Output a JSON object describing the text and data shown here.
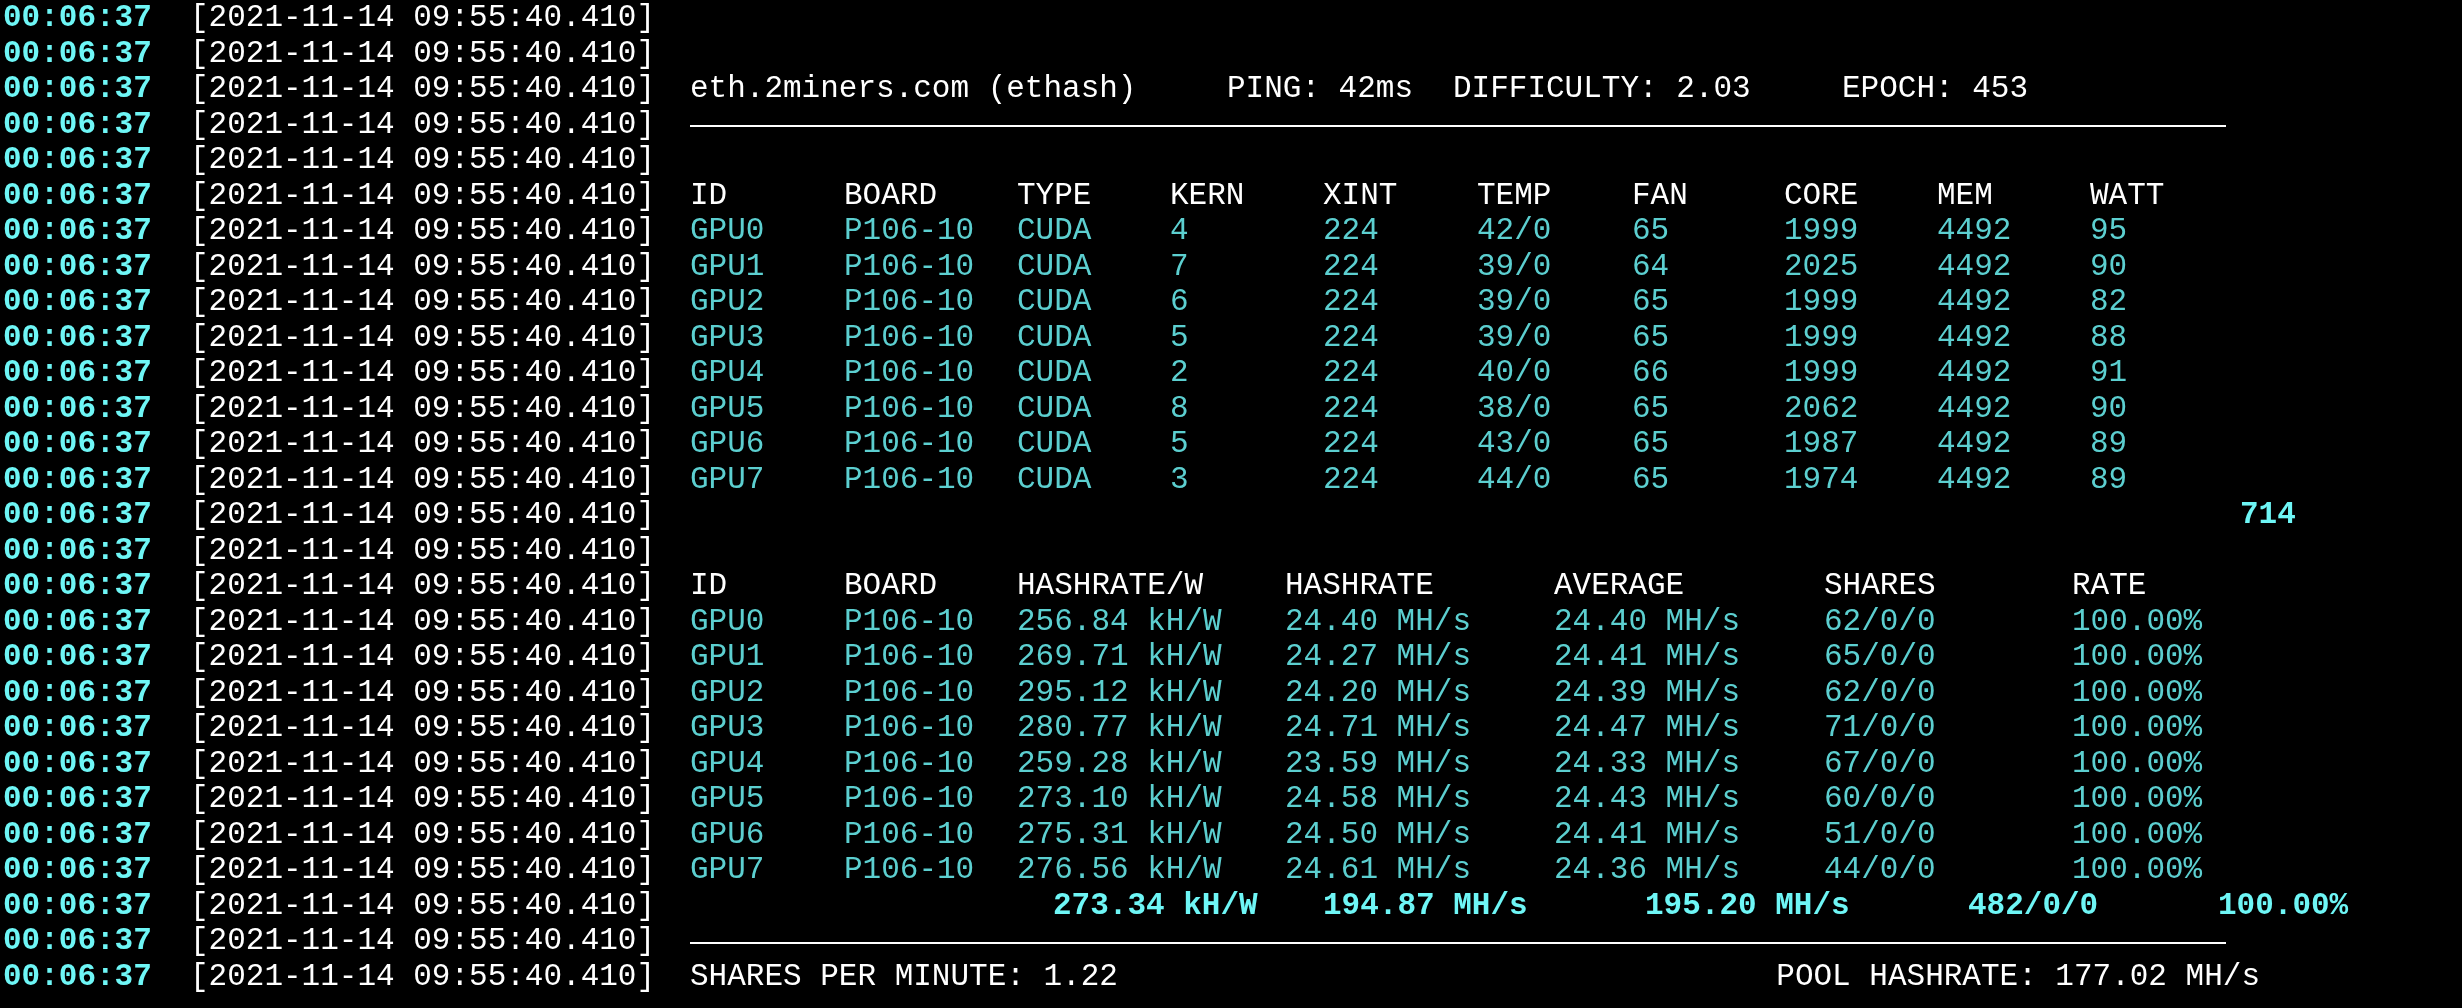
{
  "lines": [
    {
      "time": "00:06:37",
      "stamp": "[2021-11-14 09:55:40.410]",
      "kind": "blank"
    },
    {
      "time": "00:06:37",
      "stamp": "[2021-11-14 09:55:40.410]",
      "kind": "blank"
    },
    {
      "time": "00:06:37",
      "stamp": "[2021-11-14 09:55:40.410]",
      "kind": "pool",
      "cells": [
        "eth.2miners.com (ethash)",
        "PING: 42ms",
        "DIFFICULTY: 2.03",
        "EPOCH: 453"
      ]
    },
    {
      "time": "00:06:37",
      "stamp": "[2021-11-14 09:55:40.410]",
      "kind": "rule"
    },
    {
      "time": "00:06:37",
      "stamp": "[2021-11-14 09:55:40.410]",
      "kind": "blank"
    },
    {
      "time": "00:06:37",
      "stamp": "[2021-11-14 09:55:40.410]",
      "kind": "header1",
      "cells": [
        "ID",
        "BOARD",
        "TYPE",
        "KERN",
        "XINT",
        "TEMP",
        "FAN",
        "CORE",
        "MEM",
        "WATT"
      ]
    },
    {
      "time": "00:06:37",
      "stamp": "[2021-11-14 09:55:40.410]",
      "kind": "row1",
      "cells": [
        "GPU0",
        "P106-10",
        "CUDA",
        "4",
        "224",
        "42/0",
        "65",
        "1999",
        "4492",
        "95"
      ]
    },
    {
      "time": "00:06:37",
      "stamp": "[2021-11-14 09:55:40.410]",
      "kind": "row1",
      "cells": [
        "GPU1",
        "P106-10",
        "CUDA",
        "7",
        "224",
        "39/0",
        "64",
        "2025",
        "4492",
        "90"
      ]
    },
    {
      "time": "00:06:37",
      "stamp": "[2021-11-14 09:55:40.410]",
      "kind": "row1",
      "cells": [
        "GPU2",
        "P106-10",
        "CUDA",
        "6",
        "224",
        "39/0",
        "65",
        "1999",
        "4492",
        "82"
      ]
    },
    {
      "time": "00:06:37",
      "stamp": "[2021-11-14 09:55:40.410]",
      "kind": "row1",
      "cells": [
        "GPU3",
        "P106-10",
        "CUDA",
        "5",
        "224",
        "39/0",
        "65",
        "1999",
        "4492",
        "88"
      ]
    },
    {
      "time": "00:06:37",
      "stamp": "[2021-11-14 09:55:40.410]",
      "kind": "row1",
      "cells": [
        "GPU4",
        "P106-10",
        "CUDA",
        "2",
        "224",
        "40/0",
        "66",
        "1999",
        "4492",
        "91"
      ]
    },
    {
      "time": "00:06:37",
      "stamp": "[2021-11-14 09:55:40.410]",
      "kind": "row1",
      "cells": [
        "GPU5",
        "P106-10",
        "CUDA",
        "8",
        "224",
        "38/0",
        "65",
        "2062",
        "4492",
        "90"
      ]
    },
    {
      "time": "00:06:37",
      "stamp": "[2021-11-14 09:55:40.410]",
      "kind": "row1",
      "cells": [
        "GPU6",
        "P106-10",
        "CUDA",
        "5",
        "224",
        "43/0",
        "65",
        "1987",
        "4492",
        "89"
      ]
    },
    {
      "time": "00:06:37",
      "stamp": "[2021-11-14 09:55:40.410]",
      "kind": "row1",
      "cells": [
        "GPU7",
        "P106-10",
        "CUDA",
        "3",
        "224",
        "44/0",
        "65",
        "1974",
        "4492",
        "89"
      ]
    },
    {
      "time": "00:06:37",
      "stamp": "[2021-11-14 09:55:40.410]",
      "kind": "total1",
      "cells": [
        "714"
      ]
    },
    {
      "time": "00:06:37",
      "stamp": "[2021-11-14 09:55:40.410]",
      "kind": "blank"
    },
    {
      "time": "00:06:37",
      "stamp": "[2021-11-14 09:55:40.410]",
      "kind": "header2",
      "cells": [
        "ID",
        "BOARD",
        "HASHRATE/W",
        "HASHRATE",
        "AVERAGE",
        "SHARES",
        "RATE"
      ]
    },
    {
      "time": "00:06:37",
      "stamp": "[2021-11-14 09:55:40.410]",
      "kind": "row2",
      "cells": [
        "GPU0",
        "P106-10",
        "256.84 kH/W",
        "24.40 MH/s",
        "24.40 MH/s",
        "62/0/0",
        "100.00%"
      ]
    },
    {
      "time": "00:06:37",
      "stamp": "[2021-11-14 09:55:40.410]",
      "kind": "row2",
      "cells": [
        "GPU1",
        "P106-10",
        "269.71 kH/W",
        "24.27 MH/s",
        "24.41 MH/s",
        "65/0/0",
        "100.00%"
      ]
    },
    {
      "time": "00:06:37",
      "stamp": "[2021-11-14 09:55:40.410]",
      "kind": "row2",
      "cells": [
        "GPU2",
        "P106-10",
        "295.12 kH/W",
        "24.20 MH/s",
        "24.39 MH/s",
        "62/0/0",
        "100.00%"
      ]
    },
    {
      "time": "00:06:37",
      "stamp": "[2021-11-14 09:55:40.410]",
      "kind": "row2",
      "cells": [
        "GPU3",
        "P106-10",
        "280.77 kH/W",
        "24.71 MH/s",
        "24.47 MH/s",
        "71/0/0",
        "100.00%"
      ]
    },
    {
      "time": "00:06:37",
      "stamp": "[2021-11-14 09:55:40.410]",
      "kind": "row2",
      "cells": [
        "GPU4",
        "P106-10",
        "259.28 kH/W",
        "23.59 MH/s",
        "24.33 MH/s",
        "67/0/0",
        "100.00%"
      ]
    },
    {
      "time": "00:06:37",
      "stamp": "[2021-11-14 09:55:40.410]",
      "kind": "row2",
      "cells": [
        "GPU5",
        "P106-10",
        "273.10 kH/W",
        "24.58 MH/s",
        "24.43 MH/s",
        "60/0/0",
        "100.00%"
      ]
    },
    {
      "time": "00:06:37",
      "stamp": "[2021-11-14 09:55:40.410]",
      "kind": "row2",
      "cells": [
        "GPU6",
        "P106-10",
        "275.31 kH/W",
        "24.50 MH/s",
        "24.41 MH/s",
        "51/0/0",
        "100.00%"
      ]
    },
    {
      "time": "00:06:37",
      "stamp": "[2021-11-14 09:55:40.410]",
      "kind": "row2",
      "cells": [
        "GPU7",
        "P106-10",
        "276.56 kH/W",
        "24.61 MH/s",
        "24.36 MH/s",
        "44/0/0",
        "100.00%"
      ]
    },
    {
      "time": "00:06:37",
      "stamp": "[2021-11-14 09:55:40.410]",
      "kind": "total2",
      "cells": [
        "273.34 kH/W",
        "194.87 MH/s",
        "195.20 MH/s",
        "482/0/0",
        "100.00%"
      ]
    },
    {
      "time": "00:06:37",
      "stamp": "[2021-11-14 09:55:40.410]",
      "kind": "rule"
    },
    {
      "time": "00:06:37",
      "stamp": "[2021-11-14 09:55:40.410]",
      "kind": "footer",
      "cells": [
        "SHARES PER MINUTE: 1.22",
        "POOL HASHRATE: 177.02 MH/s"
      ]
    }
  ]
}
